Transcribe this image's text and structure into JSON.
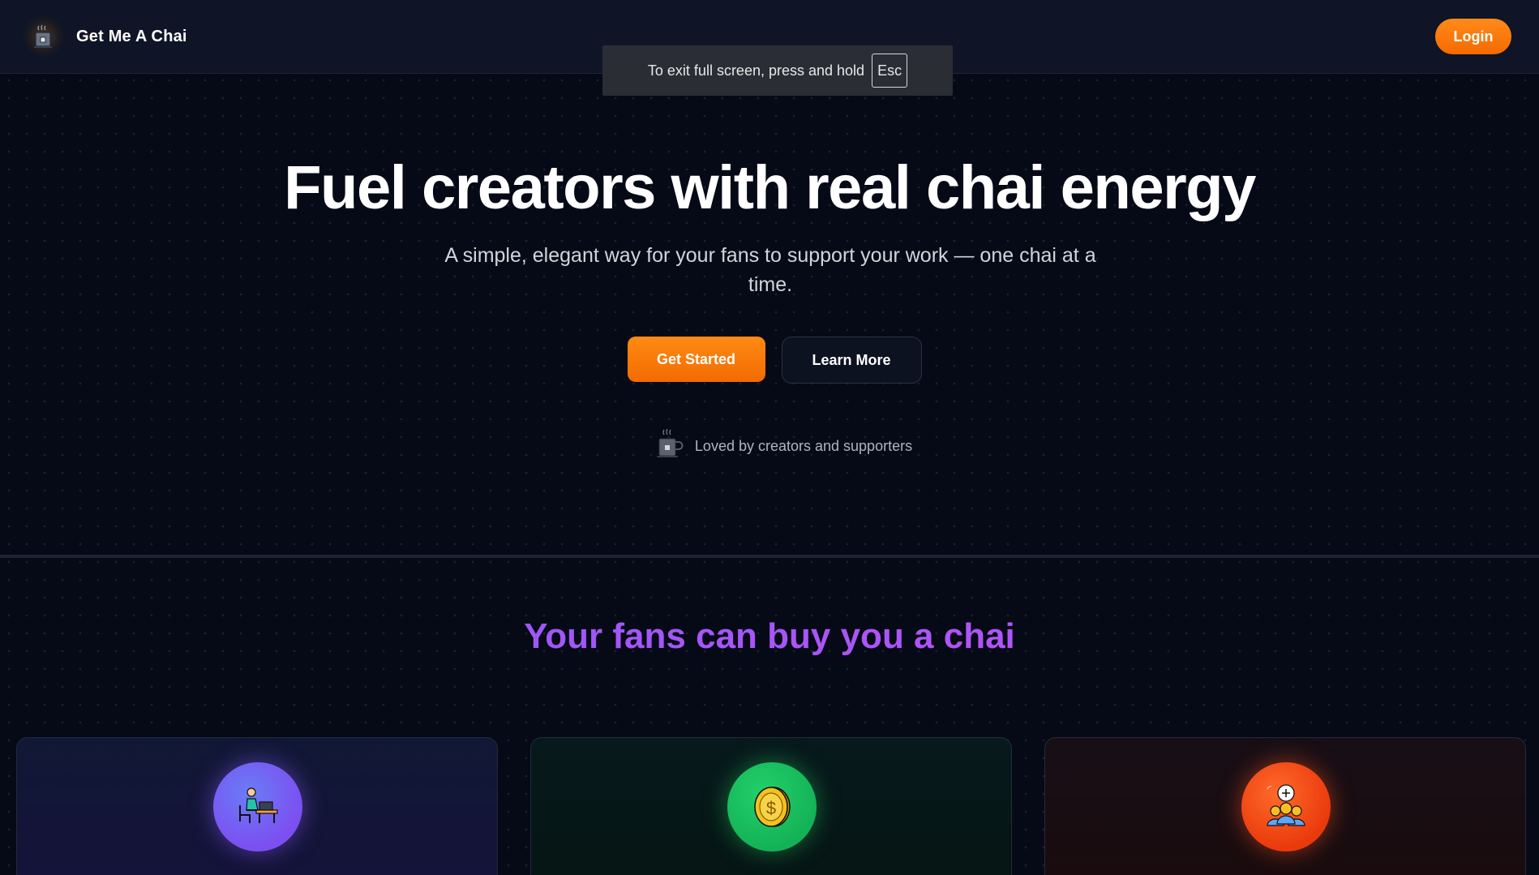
{
  "nav": {
    "brand": "Get Me A Chai",
    "login_label": "Login"
  },
  "fullscreen_toast": {
    "text": "To exit full screen, press and hold",
    "key": "Esc"
  },
  "hero": {
    "title": "Fuel creators with real chai energy",
    "subtitle": "A simple, elegant way for your fans to support your work — one chai at a time.",
    "primary_cta": "Get Started",
    "secondary_cta": "Learn More",
    "loved_text": "Loved by creators and supporters"
  },
  "features": {
    "title": "Your fans can buy you a chai",
    "cards": [
      {
        "icon": "creator-at-desk-icon",
        "accent": "#7c4ff0"
      },
      {
        "icon": "coin-icon",
        "accent": "#14b257"
      },
      {
        "icon": "community-icon",
        "accent": "#ea3a0c"
      }
    ]
  },
  "colors": {
    "background": "#060a17",
    "navbar": "#0f1526",
    "accent_orange": "#f56a00",
    "heading_purple": "#a855f7"
  }
}
